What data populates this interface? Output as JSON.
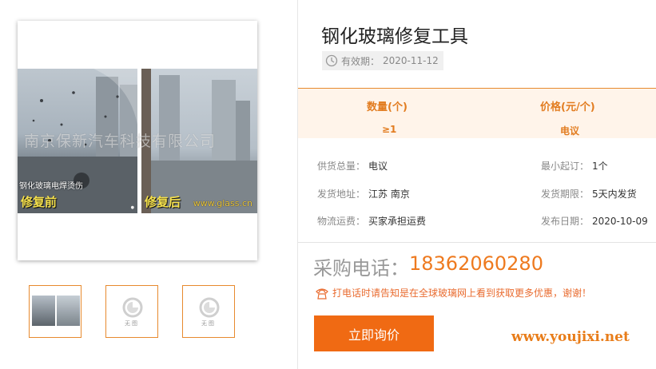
{
  "gallery": {
    "main_image": {
      "caption": "钢化玻璃电焊烫伤",
      "label_before": "修复前",
      "label_after": "修复后",
      "photo_site_text": "www.glass.cn",
      "watermark": "南京保新汽车科技有限公司"
    },
    "thumbnails": [
      {
        "type": "photo"
      },
      {
        "type": "no-image",
        "text": "无图"
      },
      {
        "type": "no-image",
        "text": "无图"
      }
    ]
  },
  "product": {
    "title": "钢化玻璃修复工具",
    "validity_label": "有效期：",
    "validity_date": "2020-11-12"
  },
  "price_table": {
    "quantity_header": "数量(个)",
    "price_header": "价格(元/个)",
    "quantity_value": "≥1",
    "price_value": "电议"
  },
  "attributes": {
    "supply_total": {
      "label": "供货总量：",
      "value": "电议"
    },
    "min_order": {
      "label": "最小起订：",
      "value": "1个"
    },
    "ship_from": {
      "label": "发货地址：",
      "value": "江苏 南京"
    },
    "ship_period": {
      "label": "发货期限：",
      "value": "5天内发货"
    },
    "freight": {
      "label": "物流运费：",
      "value": "买家承担运费"
    },
    "publish_date": {
      "label": "发布日期：",
      "value": "2020-10-09"
    }
  },
  "contact": {
    "phone_label": "采购电话：",
    "phone_number": "18362060280",
    "notice": "打电话时请告知是在全球玻璃网上看到获取更多优惠，谢谢！",
    "inquiry_button_label": "立即询价"
  },
  "footer_watermark": "www.youjixi.net",
  "colors": {
    "accent": "#f06a13",
    "accent_text": "#e27c20",
    "price_bg": "#fff4ea"
  }
}
